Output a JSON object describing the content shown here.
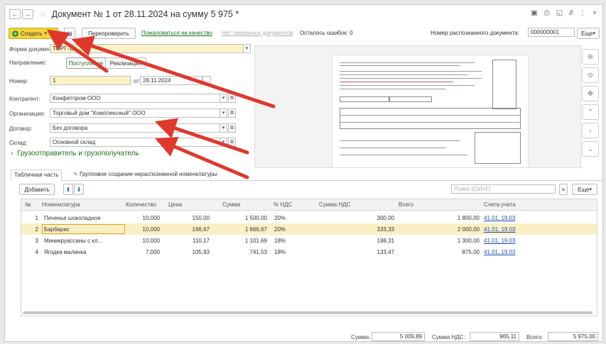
{
  "window": {
    "title": "Документ № 1 от 28.11.2024 на сумму 5 975 *"
  },
  "toolbar": {
    "create_label": "Создать",
    "recheck_label": "Перепроверить",
    "complain_link": "Пожаловаться на качество",
    "related_link": "Нет связанных документов",
    "errors_left": "Осталось ошибок: 0",
    "recognized_label": "Номер распознанного документа:",
    "recognized_value": "000000001",
    "more_label": "Еще"
  },
  "form": {
    "doc_form_label": "Форма документа:",
    "doc_form_value": "ТОРГ-12",
    "direction_label": "Направление:",
    "direction_in": "Поступление",
    "direction_out": "Реализация",
    "number_label": "Номер:",
    "number_value": "1",
    "date_label": "от:",
    "date_value": "28.11.2024",
    "contractor_label": "Контрагент:",
    "contractor_value": "Конфетпром ООО",
    "org_label": "Организация:",
    "org_value": "Торговый дом \"Комплексный\" ООО",
    "contract_label": "Договор:",
    "contract_value": "Без договора",
    "warehouse_label": "Склад:",
    "warehouse_value": "Основной склад",
    "consignor_section": "Грузоотправитель и грузополучатель"
  },
  "tabs": [
    {
      "label": "Табличная часть"
    },
    {
      "label": "Групповое создание нераспознанной номенклатуры"
    }
  ],
  "table_toolbar": {
    "add_label": "Добавить",
    "search_placeholder": "Поиск (Ctrl+F)",
    "more_label": "Еще"
  },
  "table": {
    "columns": [
      "№",
      "Номенклатура",
      "Количество",
      "Цена",
      "Сумма",
      "% НДС",
      "Сумма НДС",
      "Всего",
      "Счета учета"
    ],
    "rows": [
      {
        "n": "1",
        "name": "Печенье шоколадное",
        "qty": "10,000",
        "price": "150,00",
        "sum": "1 500,00",
        "vat": "20%",
        "vat_sum": "300,00",
        "total": "1 800,00",
        "account": "41.01, 19.03"
      },
      {
        "n": "2",
        "name": "Барбарис",
        "qty": "10,000",
        "price": "166,67",
        "sum": "1 666,67",
        "vat": "20%",
        "vat_sum": "333,33",
        "total": "2 000,00",
        "account": "41.01, 19.03"
      },
      {
        "n": "3",
        "name": "Миникруассаны с кл...",
        "qty": "10,000",
        "price": "110,17",
        "sum": "1 101,69",
        "vat": "18%",
        "vat_sum": "198,31",
        "total": "1 300,00",
        "account": "41.01, 19.03"
      },
      {
        "n": "4",
        "name": "Ягодка малинка",
        "qty": "7,000",
        "price": "105,93",
        "sum": "741,53",
        "vat": "18%",
        "vat_sum": "133,47",
        "total": "875,00",
        "account": "41.01, 19.03"
      }
    ]
  },
  "footer": {
    "sum_label": "Сумма:",
    "sum_value": "5 009,89",
    "vat_label": "Сумма НДС:",
    "vat_value": "965,11",
    "total_label": "Всего:",
    "total_value": "5 975,00"
  },
  "colors": {
    "accent_yellow": "#f5d33a",
    "link_green": "#1a6e1a",
    "annotation_red": "#e0382c",
    "selection": "#fbf0c4"
  }
}
